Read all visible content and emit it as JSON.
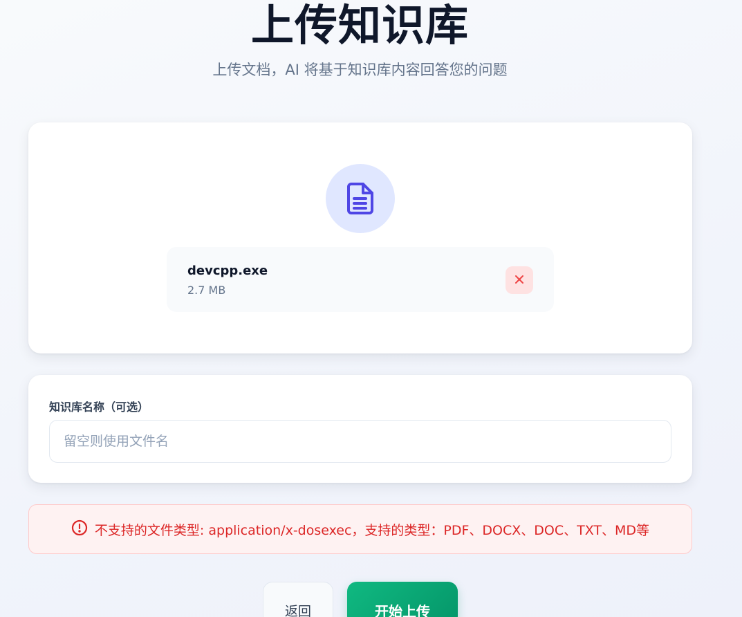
{
  "header": {
    "title": "上传知识库",
    "subtitle": "上传文档，AI 将基于知识库内容回答您的问题"
  },
  "upload": {
    "icon": "document-icon",
    "file": {
      "name": "devcpp.exe",
      "size": "2.7 MB",
      "remove_icon": "close-icon"
    }
  },
  "name_field": {
    "label": "知识库名称（可选）",
    "value": "",
    "placeholder": "留空则使用文件名"
  },
  "error": {
    "icon": "alert-circle-icon",
    "message": "不支持的文件类型: application/x-dosexec，支持的类型：PDF、DOCX、DOC、TXT、MD等"
  },
  "actions": {
    "back_label": "返回",
    "start_label": "开始上传"
  },
  "colors": {
    "accent": "#4f46e5",
    "accent_bg": "#e0e7ff",
    "error": "#dc2626",
    "error_bg": "#fef2f2",
    "primary_button": "#10b981"
  }
}
